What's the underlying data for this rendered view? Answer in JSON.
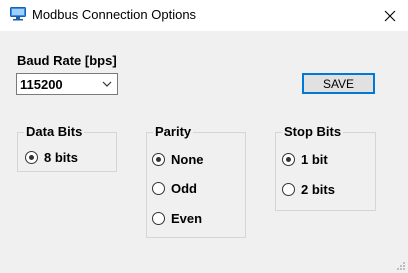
{
  "window": {
    "title": "Modbus Connection Options",
    "icon": "modbus-app-icon",
    "close_glyph": "✕"
  },
  "baud": {
    "label": "Baud Rate [bps]",
    "value": "115200"
  },
  "save_label": "SAVE",
  "data_bits": {
    "title": "Data Bits",
    "options": [
      {
        "label": "8 bits",
        "checked": true
      }
    ]
  },
  "parity": {
    "title": "Parity",
    "options": [
      {
        "label": "None",
        "checked": true
      },
      {
        "label": "Odd",
        "checked": false
      },
      {
        "label": "Even",
        "checked": false
      }
    ]
  },
  "stop_bits": {
    "title": "Stop Bits",
    "options": [
      {
        "label": "1 bit",
        "checked": true
      },
      {
        "label": "2 bits",
        "checked": false
      }
    ]
  },
  "colors": {
    "accent": "#0078d7",
    "background": "#f0f0f0",
    "titlebar": "#ffffff"
  }
}
